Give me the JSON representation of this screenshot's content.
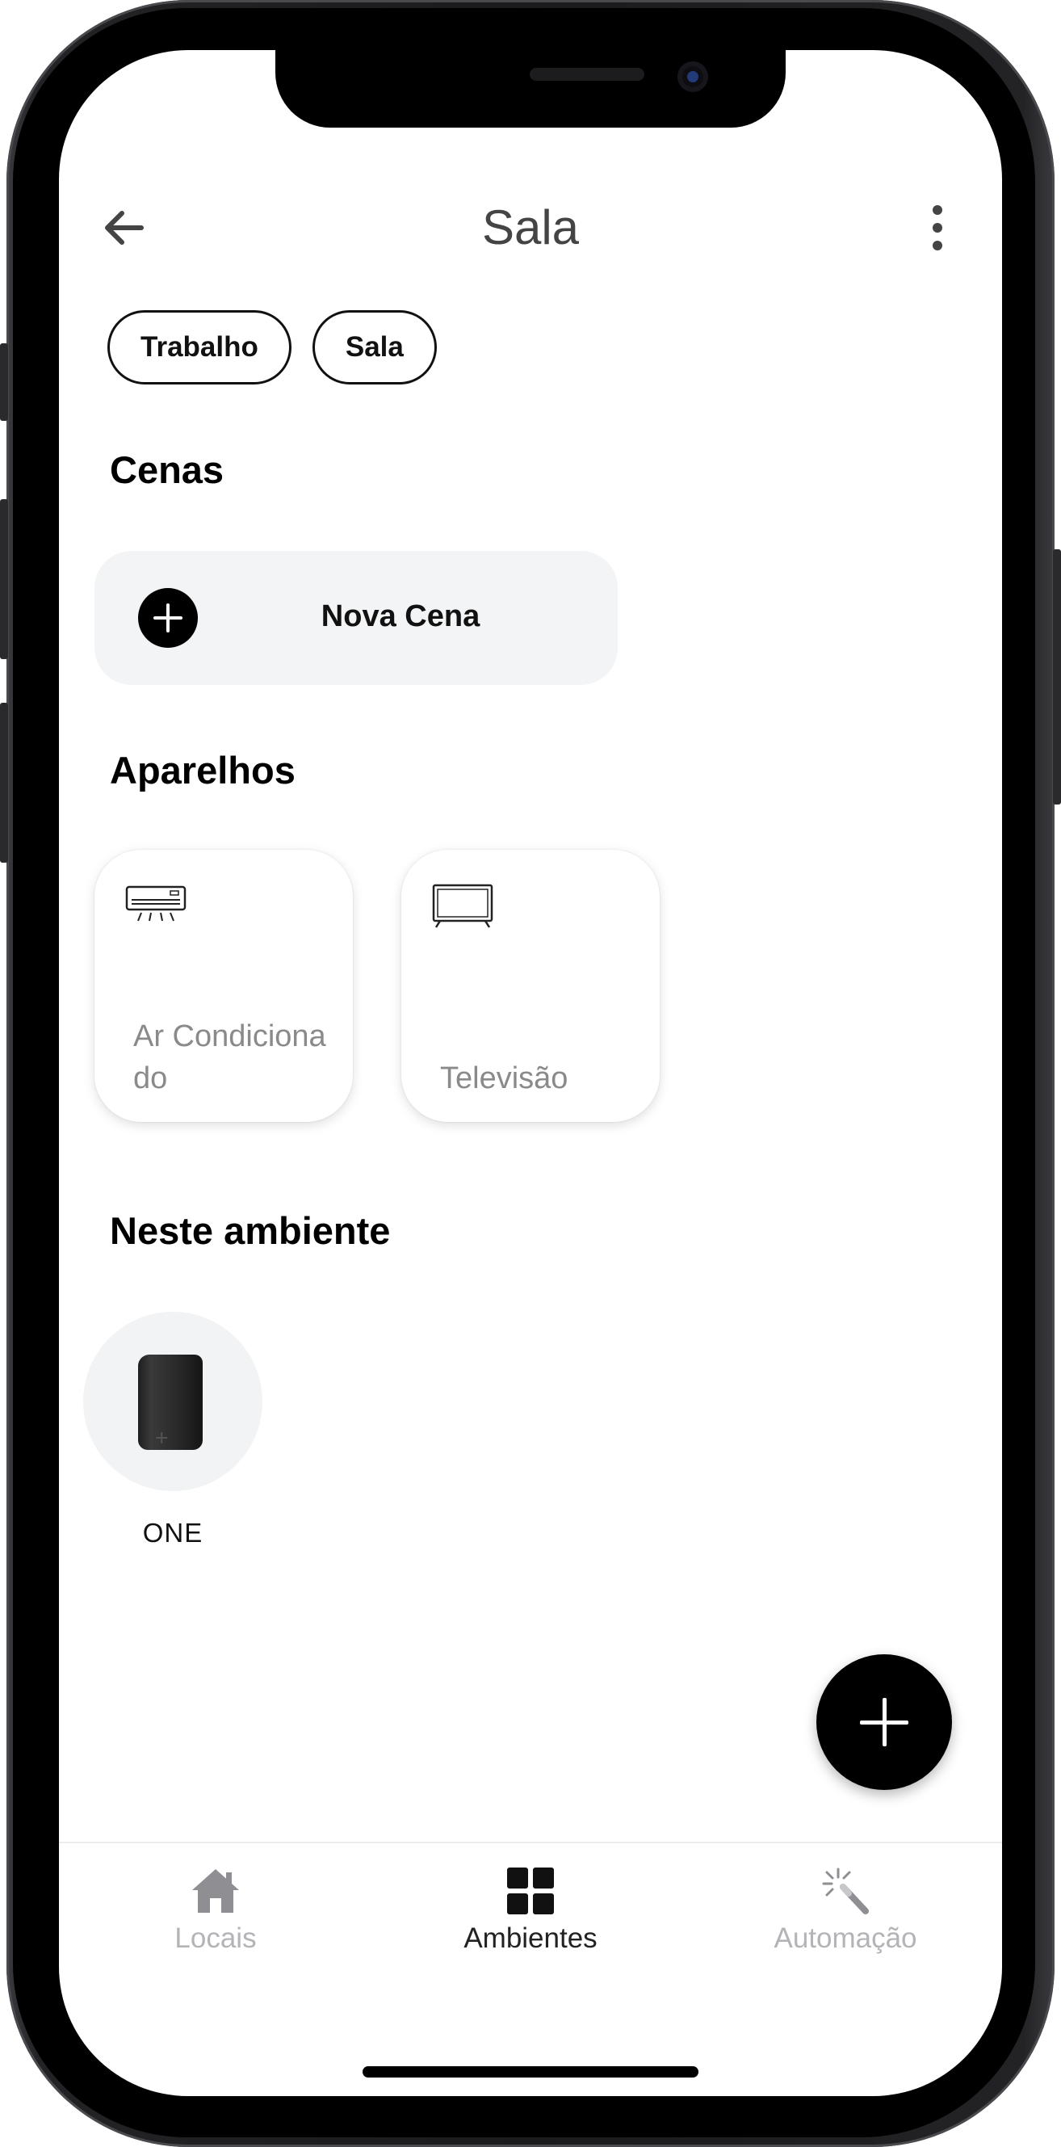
{
  "header": {
    "title": "Sala",
    "back_icon": "arrow-left-icon",
    "menu_icon": "more-vertical-icon"
  },
  "chips": [
    {
      "label": "Trabalho"
    },
    {
      "label": "Sala"
    }
  ],
  "scenes": {
    "title": "Cenas",
    "new_scene_label": "Nova Cena",
    "add_icon": "plus-circle-icon"
  },
  "devices": {
    "title": "Aparelhos",
    "items": [
      {
        "label": "Ar Condicionado",
        "icon": "air-conditioner-icon"
      },
      {
        "label": "Televisão",
        "icon": "tv-icon"
      }
    ]
  },
  "environment": {
    "title": "Neste ambiente",
    "items": [
      {
        "label": "ONE",
        "icon": "hub-device-icon"
      }
    ]
  },
  "fab": {
    "icon": "plus-icon"
  },
  "bottom_nav": {
    "items": [
      {
        "label": "Locais",
        "icon": "home-icon",
        "active": false
      },
      {
        "label": "Ambientes",
        "icon": "grid-icon",
        "active": true
      },
      {
        "label": "Automação",
        "icon": "magic-wand-icon",
        "active": false
      }
    ]
  },
  "colors": {
    "active": "#222222",
    "inactive": "#b4b4b8",
    "card_bg": "#f3f4f5"
  }
}
